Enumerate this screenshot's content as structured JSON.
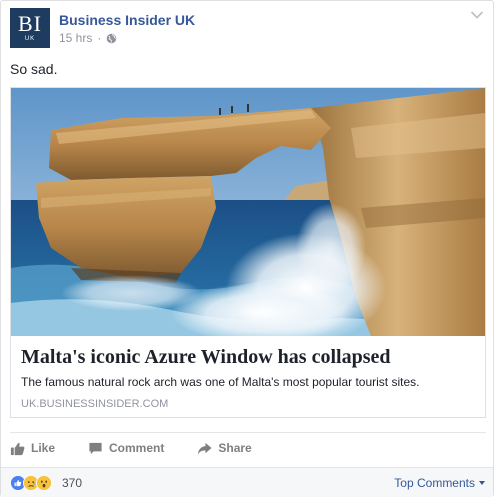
{
  "post": {
    "page_name": "Business Insider UK",
    "logo_text": "BI",
    "logo_subtext": "UK",
    "time": "15 hrs",
    "separator": "·",
    "privacy_icon": "globe-icon",
    "text": "So sad."
  },
  "link": {
    "title": "Malta's iconic Azure Window has collapsed",
    "description": "The famous natural rock arch was one of Malta's most popular tourist sites.",
    "domain": "UK.BUSINESSINSIDER.COM",
    "image_subject": "azure-window-rock-arch"
  },
  "actions": {
    "like": "Like",
    "comment": "Comment",
    "share": "Share"
  },
  "reactions": {
    "count": "370",
    "types": [
      "like",
      "sad",
      "wow"
    ],
    "sort_label": "Top Comments"
  },
  "colors": {
    "brand_blue": "#365899",
    "logo_bg": "#1d3c60",
    "muted": "#90949c",
    "like_blue": "#4d7ff4",
    "emoji_yellow": "#f7c23c"
  }
}
